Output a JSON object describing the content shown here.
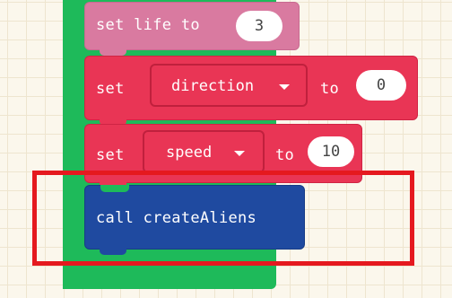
{
  "blocks": {
    "set_life": {
      "keyword": "set life to",
      "value": "3"
    },
    "set_direction": {
      "keyword": "set",
      "variable": "direction",
      "to_label": "to",
      "value": "0"
    },
    "set_speed": {
      "keyword": "set",
      "variable": "speed",
      "to_label": "to",
      "value": "10"
    },
    "call_create_aliens": {
      "label": "call createAliens"
    }
  },
  "colors": {
    "workspace_bg": "#fbf7ec",
    "event_green": "#1eba5a",
    "variables_red": "#e93555",
    "variables_faded": "#d97aa0",
    "functions_blue": "#1f4aa0",
    "highlight_red": "#e5191f"
  }
}
